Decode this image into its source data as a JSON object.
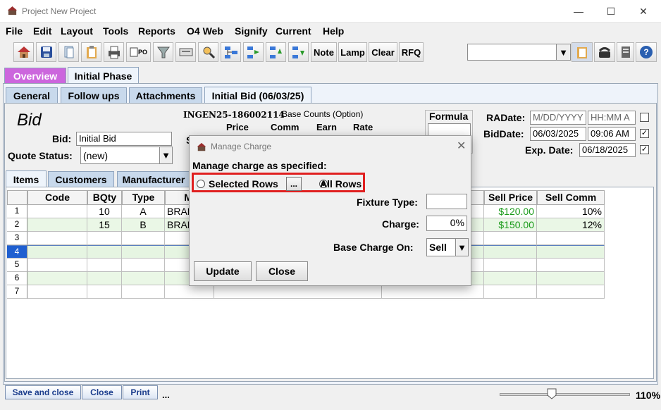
{
  "window": {
    "title": "Project New Project"
  },
  "menubar": [
    "File",
    "Edit",
    "Layout",
    "Tools",
    "Reports",
    "O4 Web",
    "Signify",
    "Current",
    "Help"
  ],
  "toolbar": {
    "text_buttons": [
      "Note",
      "Lamp",
      "Clear",
      "RFQ"
    ],
    "icons": [
      "home-icon",
      "save-icon",
      "copy-icon",
      "clipboard-icon",
      "print-icon",
      "po-icon",
      "filter-icon",
      "keyboard-icon",
      "search-user-icon",
      "tree-icon",
      "tree-right-icon",
      "tree-up-icon",
      "tree-down-icon"
    ],
    "po_label": "PO",
    "right_icons": [
      "clipboard-icon",
      "phone-icon",
      "database-icon",
      "help-icon"
    ]
  },
  "top_tabs": [
    "Overview",
    "Initial Phase"
  ],
  "sub_tabs": [
    "General",
    "Follow ups",
    "Attachments",
    "Initial Bid (06/03/25)"
  ],
  "bid": {
    "heading": "Bid",
    "bid_label": "Bid:",
    "bid_value": "Initial Bid",
    "quote_status_label": "Quote Status:",
    "quote_status_value": "(new)",
    "code": "INGEN25-186002114",
    "base_counts": "Base Counts (Option)",
    "col_headers": [
      "Price",
      "Comm",
      "Earn",
      "Rate"
    ],
    "partial_label": "S",
    "formula_label": "Formula",
    "radate_label": "RADate:",
    "radate_value": "M/DD/YYYY",
    "radate_time": "HH:MM A",
    "biddate_label": "BidDate:",
    "biddate_value": "06/03/2025",
    "biddate_time": "09:06 AM",
    "expdate_label": "Exp. Date:",
    "expdate_value": "06/18/2025"
  },
  "item_tabs": [
    "Items",
    "Customers",
    "Manufacturer"
  ],
  "table": {
    "left_headers": [
      "Code",
      "BQty",
      "Type",
      "MI"
    ],
    "right_headers": [
      "Sell Price",
      "Sell Comm"
    ],
    "rows": [
      {
        "num": "1",
        "code": "",
        "bqty": "10",
        "type": "A",
        "mi": "BRAN",
        "sell_price": "$120.00",
        "sell_comm": "10%"
      },
      {
        "num": "2",
        "code": "",
        "bqty": "15",
        "type": "B",
        "mi": "BRAN",
        "sell_price": "$150.00",
        "sell_comm": "12%"
      },
      {
        "num": "3",
        "code": "",
        "bqty": "",
        "type": "",
        "mi": "",
        "sell_price": "",
        "sell_comm": ""
      },
      {
        "num": "4",
        "code": "",
        "bqty": "",
        "type": "",
        "mi": "",
        "sell_price": "",
        "sell_comm": ""
      },
      {
        "num": "5",
        "code": "",
        "bqty": "",
        "type": "",
        "mi": "",
        "sell_price": "",
        "sell_comm": ""
      },
      {
        "num": "6",
        "code": "",
        "bqty": "",
        "type": "",
        "mi": "",
        "sell_price": "",
        "sell_comm": ""
      },
      {
        "num": "7",
        "code": "",
        "bqty": "",
        "type": "",
        "mi": "",
        "sell_price": "",
        "sell_comm": ""
      }
    ]
  },
  "dialog": {
    "title": "Manage Charge",
    "instruction": "Manage charge as specified:",
    "selected_rows": "Selected Rows",
    "ellipsis": "...",
    "all_rows": "All Rows",
    "fixture_type_label": "Fixture Type:",
    "fixture_type_value": "",
    "charge_label": "Charge:",
    "charge_value": "0%",
    "base_charge_label": "Base Charge On:",
    "base_charge_value": "Sell",
    "update": "Update",
    "close": "Close"
  },
  "footer": {
    "save_close": "Save and close",
    "close": "Close",
    "print": "Print",
    "more": "...",
    "zoom": "110%"
  },
  "colors": {
    "overview_tab": "#cc66dd",
    "highlight": "#e02020",
    "money_green": "#1a9a1a"
  }
}
